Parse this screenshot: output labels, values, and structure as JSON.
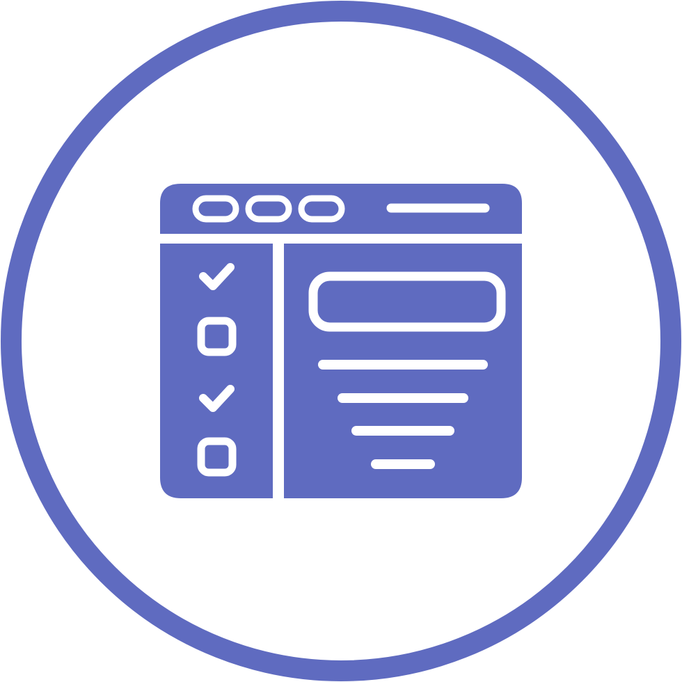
{
  "icon": {
    "name": "browser-checklist-icon",
    "description_name": "browser-window-with-checklist",
    "colors": {
      "primary": "#5f6bc0",
      "background": "#ffffff",
      "cutout": "#ffffff"
    },
    "checklist": [
      {
        "state": "checked"
      },
      {
        "state": "unchecked"
      },
      {
        "state": "checked"
      },
      {
        "state": "unchecked"
      }
    ],
    "window_dots": 3,
    "content_lines": 4
  }
}
